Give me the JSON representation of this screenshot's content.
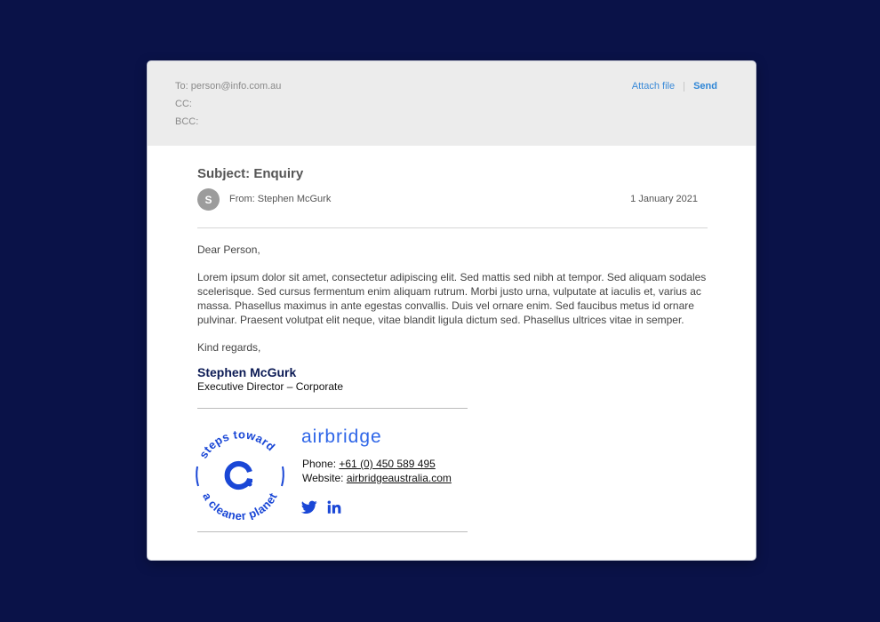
{
  "header": {
    "to_line": "To: person@info.com.au",
    "cc_line": "CC:",
    "bcc_line": "BCC:",
    "attach_label": "Attach file",
    "send_label": "Send"
  },
  "email": {
    "subject": "Subject: Enquiry",
    "avatar_initial": "S",
    "from_line": "From: Stephen McGurk",
    "date": "1 January 2021",
    "greeting": "Dear Person,",
    "body": "Lorem ipsum dolor sit amet, consectetur adipiscing elit. Sed mattis sed nibh at tempor. Sed aliquam sodales scelerisque. Sed cursus fermentum enim aliquam rutrum. Morbi justo urna, vulputate at iaculis et, varius ac massa. Phasellus maximus in ante egestas convallis. Duis vel ornare enim. Sed faucibus metus id ornare pulvinar. Praesent volutpat elit neque, vitae blandit ligula dictum sed. Phasellus ultrices vitae in semper.",
    "closing": "Kind regards,"
  },
  "signature": {
    "name": "Stephen McGurk",
    "title": "Executive Director – Corporate",
    "seal_text_top": "steps toward",
    "seal_text_bottom": "a cleaner planet",
    "brand": "airbridge",
    "phone_label": "Phone: ",
    "phone": "+61 (0) 450 589 495",
    "website_label": "Website: ",
    "website": "airbridgeaustralia.com",
    "social_icons": [
      "twitter-icon",
      "linkedin-icon"
    ]
  },
  "colors": {
    "background": "#0a1248",
    "header_bg": "#ececec",
    "link_blue": "#2f86d6",
    "brand_blue": "#1a47d6",
    "name_navy": "#0c1b55"
  }
}
